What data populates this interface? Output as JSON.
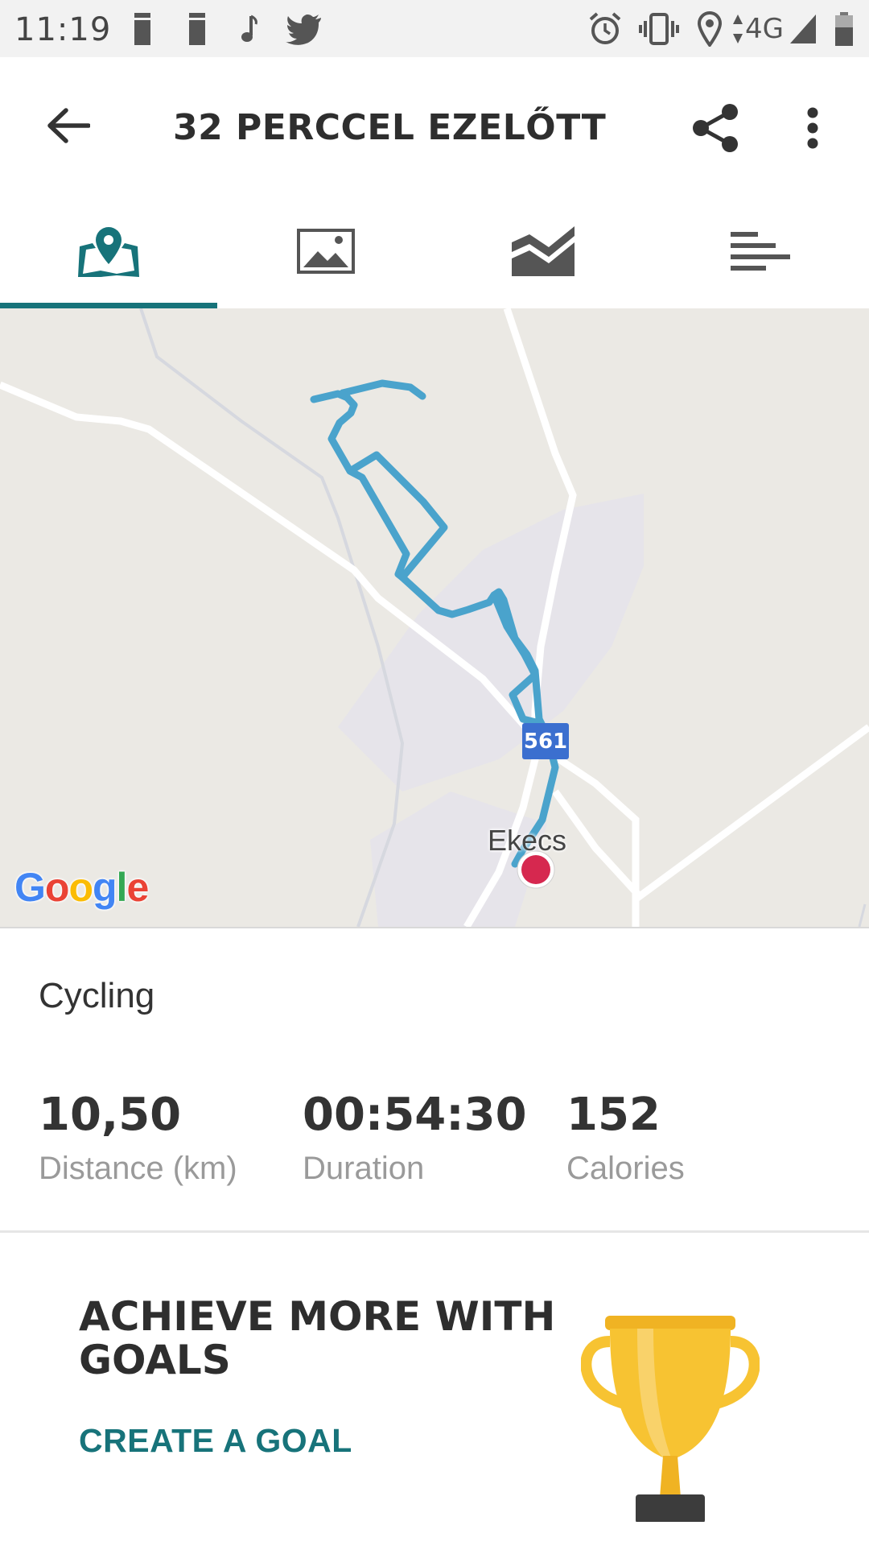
{
  "status_bar": {
    "time": "11:19",
    "network": "4G",
    "left_icons": [
      "notification-icon",
      "notification-icon",
      "music-note-icon",
      "twitter-icon"
    ],
    "right_icons": [
      "alarm-icon",
      "vibrate-icon",
      "location-icon",
      "data-arrows-icon",
      "signal-icon",
      "battery-icon"
    ]
  },
  "app_bar": {
    "title": "32 PERCCEL EZELŐTT"
  },
  "tabs": [
    {
      "icon": "map-pin-icon",
      "active": true
    },
    {
      "icon": "image-icon",
      "active": false
    },
    {
      "icon": "chart-icon",
      "active": false
    },
    {
      "icon": "list-icon",
      "active": false
    }
  ],
  "map": {
    "route_badge": "561",
    "place_label": "Ekecs",
    "logo": "Google",
    "route_color": "#4aa3cc",
    "endpoint_color": "#d6284f"
  },
  "activity": {
    "type": "Cycling",
    "stats": [
      {
        "value": "10,50",
        "label": "Distance (km)"
      },
      {
        "value": "00:54:30",
        "label": "Duration"
      },
      {
        "value": "152",
        "label": "Calories"
      }
    ]
  },
  "goals": {
    "title": "ACHIEVE MORE WITH GOALS",
    "cta": "CREATE A GOAL"
  },
  "colors": {
    "accent": "#17737a",
    "status_bar": "#f2f2f2",
    "map_background": "#ebe9e4",
    "trophy": "#f7c332"
  }
}
